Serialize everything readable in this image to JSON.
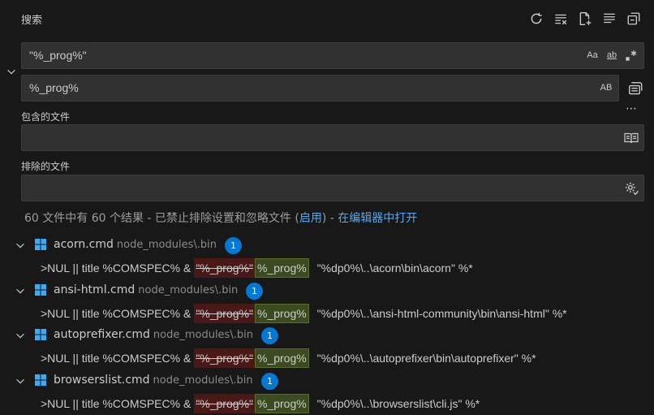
{
  "header": {
    "title": "搜索"
  },
  "search": {
    "value": "\"%_prog%\"",
    "opt_case": "Aa",
    "opt_word": "ab"
  },
  "replace": {
    "value": "%_prog%",
    "opt_preserve_case": "AB"
  },
  "includes": {
    "label": "包含的文件",
    "value": ""
  },
  "excludes": {
    "label": "排除的文件",
    "value": ""
  },
  "summary": {
    "text": "60 文件中有 60 个结果 - 已禁止排除设置和忽略文件 (",
    "enable_link": "启用",
    "close_paren": ") - ",
    "open_editor_link": "在编辑器中打开"
  },
  "results": [
    {
      "file": "acorn.cmd",
      "path": "node_modules\\.bin",
      "count": "1",
      "prefix": ">NUL || title %COMSPEC% &",
      "deleted": "\"%_prog%\"",
      "inserted": "%_prog%",
      "suffix": "\"%dp0%\\..\\acorn\\bin\\acorn\" %*"
    },
    {
      "file": "ansi-html.cmd",
      "path": "node_modules\\.bin",
      "count": "1",
      "prefix": ">NUL || title %COMSPEC% &",
      "deleted": "\"%_prog%\"",
      "inserted": "%_prog%",
      "suffix": "\"%dp0%\\..\\ansi-html-community\\bin\\ansi-html\" %*"
    },
    {
      "file": "autoprefixer.cmd",
      "path": "node_modules\\.bin",
      "count": "1",
      "prefix": ">NUL || title %COMSPEC% &",
      "deleted": "\"%_prog%\"",
      "inserted": "%_prog%",
      "suffix": "\"%dp0%\\..\\autoprefixer\\bin\\autoprefixer\" %*"
    },
    {
      "file": "browserslist.cmd",
      "path": "node_modules\\.bin",
      "count": "1",
      "prefix": ">NUL || title %COMSPEC% &",
      "deleted": "\"%_prog%\"",
      "inserted": "%_prog%",
      "suffix": "\"%dp0%\\..\\browserslist\\cli.js\" %*"
    }
  ],
  "colors": {
    "accent": "#0078d4",
    "link": "#4daafc",
    "deleted_bg": "#4b1818",
    "inserted_bg": "#3b4b1f"
  }
}
